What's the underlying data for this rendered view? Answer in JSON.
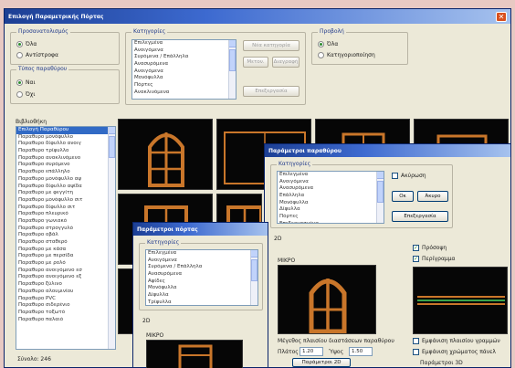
{
  "main": {
    "title": "Επιλογή Παραμετρικής Πόρτας",
    "groups": {
      "orientation": {
        "title": "Προσανατολισμός",
        "opt_a": "Όλα",
        "opt_b": "Αντίστροφα"
      },
      "type": {
        "title": "Τύπος παραθύρου",
        "opt_a": "Ναι",
        "opt_b": "Όχι"
      },
      "categories": {
        "title": "Κατηγορίες",
        "buttons": {
          "new": "Νέα κατηγορία",
          "rename": "Μετον.",
          "delete": "Διαγραφή",
          "edit": "Επεξεργασία"
        }
      },
      "view": {
        "title": "Προβολή",
        "opt_a": "Όλα",
        "opt_b": "Κατηγοριοποίηση"
      }
    },
    "category_items": [
      "Επιλεγμένα",
      "Ανοιγόμενα",
      "Συρόμενα / Επάλληλα",
      "Ανασυρόμενα",
      "Ανοιγόμενα",
      "Μονόφυλλα",
      "Πόρτες",
      "Ανακλινόμενα"
    ],
    "library_label": "Βιβλιοθήκη",
    "library_items": [
      "Επιλογή Παραθύρου",
      "Παραθυρο μονόφυλλο",
      "Παραθυρο δίφυλλο ανοιγ",
      "Παραθυρο τρίφυλλο",
      "Παραθυρο ανακλινόμενο",
      "Παραθυρο συρόμενο",
      "Παραθυρο επάλληλο",
      "Παραθυρο μονόφυλλο αψ",
      "Παραθυρο δίφυλλο αψίδα",
      "Παραθυρο με φεγγίτη",
      "Παραθυρο μονόφυλλο σιτ",
      "Παραθυρο δίφυλλο σιτ",
      "Παραθυρο πλευρικό",
      "Παραθυρο γωνιακό",
      "Παραθυρο στρογγυλό",
      "Παραθυρο οβάλ",
      "Παραθυρο σταθερό",
      "Παραθυρο με κάσα",
      "Παραθυρο με περσίδα",
      "Παραθυρο με ρολό",
      "Παραθυρο ανοιγόμενο εσ",
      "Παραθυρο ανοιγόμενο εξ",
      "Παραθυρο ξύλινο",
      "Παραθυρο αλουμινίου",
      "Παραθυρο PVC",
      "Παραθυρο σιδερένιο",
      "Παραθυρο τοξωτό",
      "Παραθυρο παλαιό"
    ],
    "count_label": "Σύνολο: 246"
  },
  "dialog_mid": {
    "title": "Παράμετροι παραθύρου",
    "group_title": "Κατηγορίες",
    "items": [
      "Επιλεγμένα",
      "Ανοιγόμενα",
      "Ανασυρόμενα",
      "Επάλληλα",
      "Μονόφυλλα",
      "Δίφυλλα",
      "Πόρτες",
      "Επεξεργασμένα"
    ],
    "check_label": "Ακύρωση",
    "ok_label": "Οκ",
    "cancel_label": "Άκυρο",
    "edit_label": "Επεξεργασία",
    "section_label": "2D",
    "preview_label": "ΜΙΚΡΟ",
    "lower_text": "Μέγεθος πλαισίου διαστάσεων παραθύρου",
    "width_label": "Πλάτος",
    "width_value": "1.20",
    "height_label": "Ύψος",
    "height_value": "1.50",
    "bottom_button": "Παράμετροι 2D",
    "right_check_a": "Πρόσοψη",
    "right_check_b": "Περίγραμμα",
    "right_check_c": "Εμφάνιση πλαισίου γραμμών",
    "right_check_d": "Εμφάνιση χρώματος πάνελ",
    "right_bottom_label": "Παράμετροι 3D"
  },
  "dialog_low": {
    "title": "Παράμετροι πόρτας",
    "group_title": "Κατηγορίες",
    "items": [
      "Επιλεγμένα",
      "Ανοιγόμενα",
      "Συρόμενα / Επάλληλα",
      "Ανασυρόμενα",
      "Αψίδες",
      "Μονόφυλλα",
      "Δίφυλλα",
      "Τρίφυλλα"
    ],
    "section_label": "2D",
    "preview_label": "ΜΙΚΡΟ"
  },
  "colors": {
    "frame": "#c9762a",
    "accent": "#316ac5"
  }
}
